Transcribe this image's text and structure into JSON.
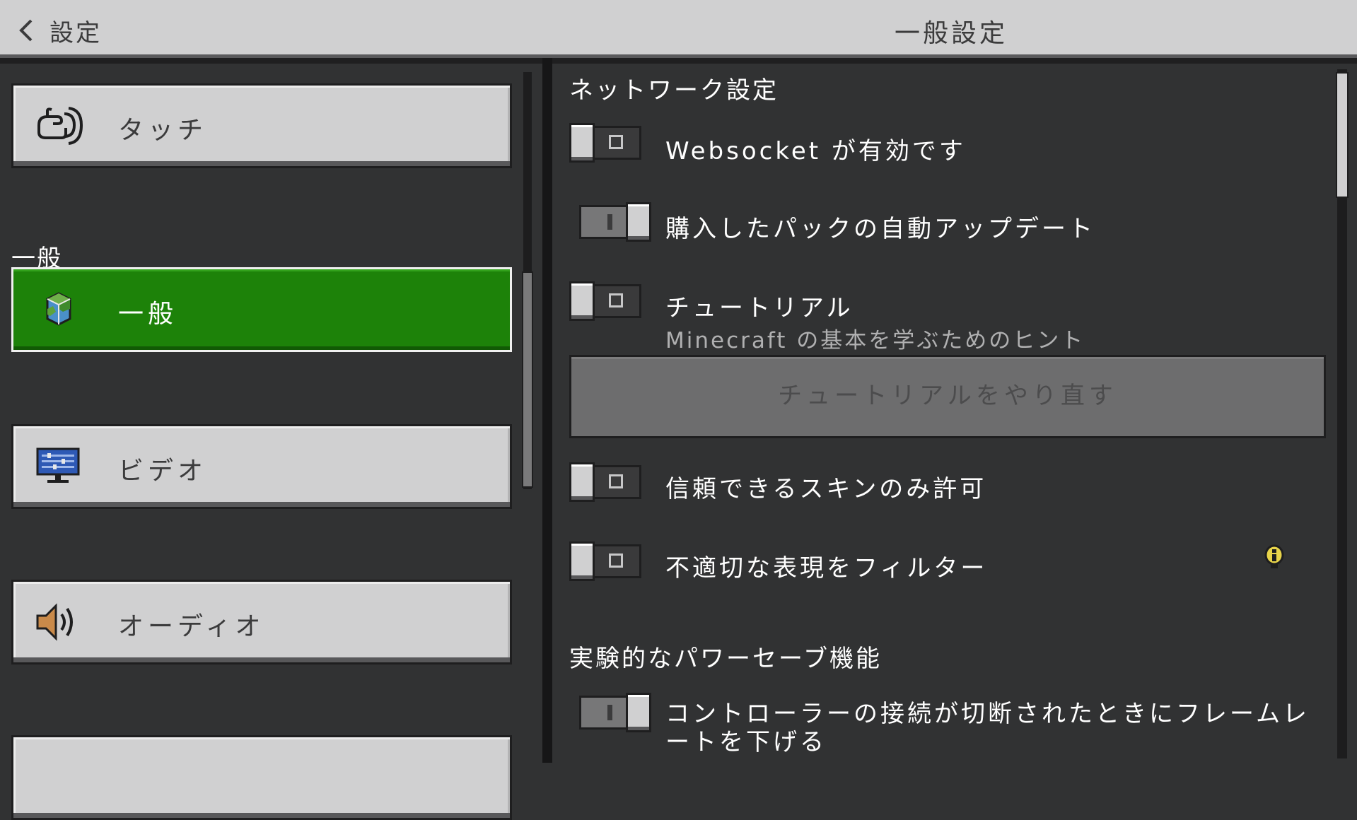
{
  "header": {
    "back_label": "設定",
    "title": "一般設定"
  },
  "sidebar": {
    "items": [
      {
        "label": "タッチ",
        "icon": "touch-hand-icon"
      },
      {
        "label": "一般",
        "icon": "globe-cube-icon",
        "active": true
      },
      {
        "label": "ビデオ",
        "icon": "monitor-icon"
      },
      {
        "label": "オーディオ",
        "icon": "speaker-icon"
      }
    ],
    "section_label": "一般"
  },
  "main": {
    "network_section": "ネットワーク設定",
    "settings": [
      {
        "label": "Websocket が有効です",
        "state": "off"
      },
      {
        "label": "購入したパックの自動アップデート",
        "state": "on"
      },
      {
        "label": "チュートリアル",
        "description": "Minecraft の基本を学ぶためのヒント",
        "state": "off"
      },
      {
        "label": "信頼できるスキンのみ許可",
        "state": "off"
      },
      {
        "label": "不適切な表現をフィルター",
        "state": "off"
      }
    ],
    "redo_tutorial_button": "チュートリアルをやり直す",
    "power_section": "実験的なパワーセーブ機能",
    "power_setting": {
      "label": "コントローラーの接続が切断されたときにフレームレートを下げる",
      "state": "on"
    }
  },
  "colors": {
    "accent_green": "#1d8209",
    "panel_bg": "#313233",
    "button_gray": "#d0d0d1"
  }
}
